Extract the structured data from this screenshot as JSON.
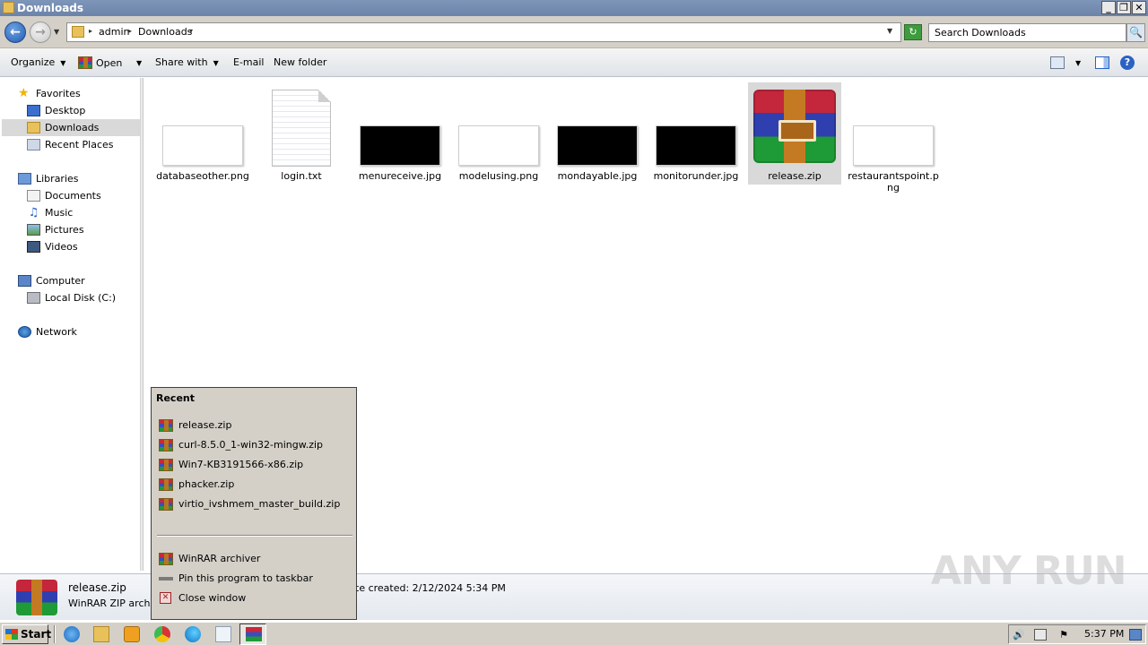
{
  "window": {
    "title": "Downloads",
    "controls": [
      "_",
      "❐",
      "✕"
    ]
  },
  "address": {
    "crumbs": [
      "admin",
      "Downloads"
    ],
    "search_placeholder": "Search Downloads"
  },
  "toolbar": {
    "organize": "Organize",
    "open": "Open",
    "share_with": "Share with",
    "email": "E-mail",
    "new_folder": "New folder"
  },
  "nav": {
    "favorites": {
      "label": "Favorites",
      "items": [
        "Desktop",
        "Downloads",
        "Recent Places"
      ]
    },
    "libraries": {
      "label": "Libraries",
      "items": [
        "Documents",
        "Music",
        "Pictures",
        "Videos"
      ]
    },
    "computer": {
      "label": "Computer",
      "items": [
        "Local Disk (C:)"
      ]
    },
    "network": {
      "label": "Network"
    }
  },
  "files": [
    {
      "name": "databaseother.png",
      "thumb": "white"
    },
    {
      "name": "login.txt",
      "thumb": "text"
    },
    {
      "name": "menureceive.jpg",
      "thumb": "black"
    },
    {
      "name": "modelusing.png",
      "thumb": "white"
    },
    {
      "name": "mondayable.jpg",
      "thumb": "black"
    },
    {
      "name": "monitorunder.jpg",
      "thumb": "black"
    },
    {
      "name": "release.zip",
      "thumb": "winrar",
      "selected": true
    },
    {
      "name": "restaurantspoint.png",
      "thumb": "white"
    }
  ],
  "details": {
    "name": "release.zip",
    "type": "WinRAR ZIP archive",
    "created": "te created: 2/12/2024 5:34 PM"
  },
  "jumplist": {
    "title": "Recent",
    "recent": [
      "release.zip",
      "curl-8.5.0_1-win32-mingw.zip",
      "Win7-KB3191566-x86.zip",
      "phacker.zip",
      "virtio_ivshmem_master_build.zip"
    ],
    "tasks": [
      "WinRAR archiver",
      "Pin this program to taskbar",
      "Close window"
    ]
  },
  "taskbar": {
    "start": "Start",
    "clock": "5:37 PM"
  },
  "watermark": "ANY RUN"
}
